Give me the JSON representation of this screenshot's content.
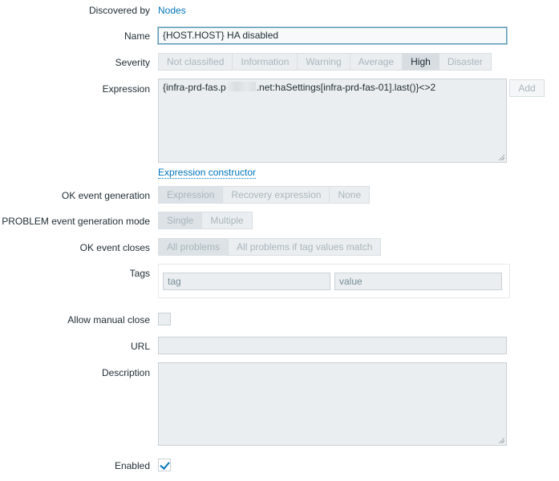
{
  "discovered_by": {
    "label": "Discovered by",
    "link": "Nodes"
  },
  "name": {
    "label": "Name",
    "value": "{HOST.HOST} HA disabled"
  },
  "severity": {
    "label": "Severity",
    "options": [
      "Not classified",
      "Information",
      "Warning",
      "Average",
      "High",
      "Disaster"
    ],
    "selected": "High"
  },
  "expression": {
    "label": "Expression",
    "value_prefix": "{infra-prd-fas.p",
    "value_suffix": ".net:haSettings[infra-prd-fas-01].last()}<>2",
    "add_label": "Add",
    "constructor_link": "Expression constructor"
  },
  "ok_event_generation": {
    "label": "OK event generation",
    "options": [
      "Expression",
      "Recovery expression",
      "None"
    ],
    "selected": "Expression"
  },
  "problem_mode": {
    "label": "PROBLEM event generation mode",
    "options": [
      "Single",
      "Multiple"
    ],
    "selected": "Single"
  },
  "ok_event_closes": {
    "label": "OK event closes",
    "options": [
      "All problems",
      "All problems if tag values match"
    ],
    "selected": "All problems"
  },
  "tags": {
    "label": "Tags",
    "tag_placeholder": "tag",
    "value_placeholder": "value"
  },
  "allow_manual_close": {
    "label": "Allow manual close",
    "checked": false
  },
  "url": {
    "label": "URL",
    "value": ""
  },
  "description": {
    "label": "Description",
    "value": ""
  },
  "enabled": {
    "label": "Enabled",
    "checked": true
  },
  "colors": {
    "link": "#0275b8",
    "field_bg": "#ebeef0",
    "selected_segment": "#d7dde1"
  }
}
